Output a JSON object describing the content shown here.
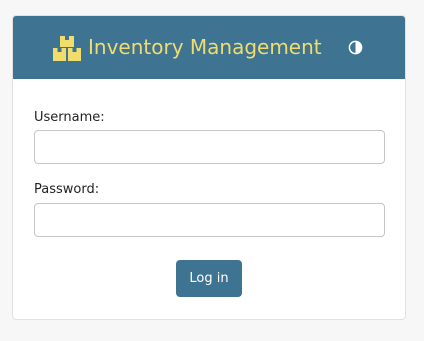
{
  "header": {
    "title": "Inventory Management",
    "logo_icon": "boxes-icon",
    "theme_icon": "contrast-icon"
  },
  "form": {
    "username_label": "Username:",
    "username_value": "",
    "password_label": "Password:",
    "password_value": "",
    "submit_label": "Log in"
  },
  "colors": {
    "header_bg": "#3e7491",
    "title": "#f1dc6e",
    "button_bg": "#3e7491",
    "button_text": "#ffffff"
  }
}
